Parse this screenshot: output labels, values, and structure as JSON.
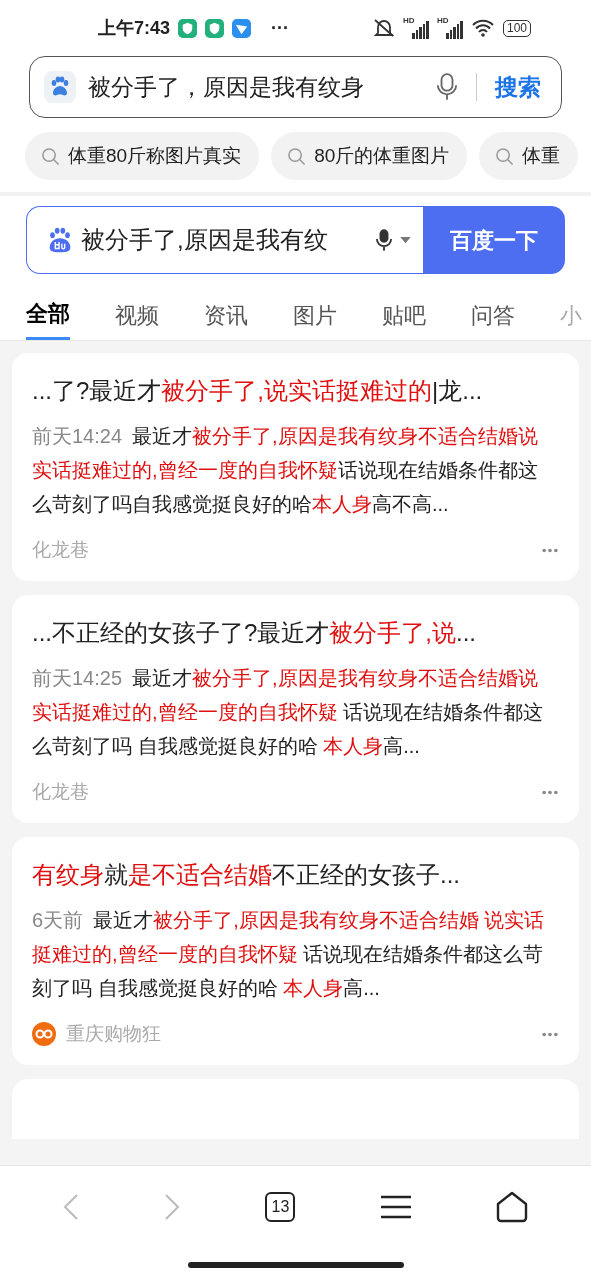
{
  "status_bar": {
    "time": "上午7:43",
    "more": "···",
    "signal_labels": [
      "HD",
      "HD"
    ],
    "battery": "100"
  },
  "top_search": {
    "value": "被分手了，原因是我有纹身",
    "button": "搜索"
  },
  "suggestions": [
    "体重80斤称图片真实",
    "80斤的体重图片",
    "体重"
  ],
  "baidu_search": {
    "value": "被分手了,原因是我有纹",
    "button": "百度一下"
  },
  "tabs": [
    {
      "label": "全部",
      "selected": true
    },
    {
      "label": "视频",
      "selected": false
    },
    {
      "label": "资讯",
      "selected": false
    },
    {
      "label": "图片",
      "selected": false
    },
    {
      "label": "贴吧",
      "selected": false
    },
    {
      "label": "问答",
      "selected": false
    },
    {
      "label": "小",
      "selected": false
    }
  ],
  "results": [
    {
      "title": [
        {
          "text": "...了?最近才",
          "highlight": false
        },
        {
          "text": "被分手了,说实话挺难过的",
          "highlight": true
        },
        {
          "text": "|龙...",
          "highlight": false
        }
      ],
      "date": "前天14:24",
      "snippet": [
        {
          "text": "最近才",
          "highlight": false
        },
        {
          "text": "被分手了,原因是我有纹身不适合结婚说实话挺难过的,曾经一度的自我怀疑",
          "highlight": true
        },
        {
          "text": "话说现在结婚条件都这么苛刻了吗自我感觉挺良好的哈",
          "highlight": false
        },
        {
          "text": "本人身",
          "highlight": true
        },
        {
          "text": "高不高...",
          "highlight": false
        }
      ],
      "source": "化龙巷",
      "source_logo": false
    },
    {
      "title": [
        {
          "text": "...不正经的女孩子了?最近才",
          "highlight": false
        },
        {
          "text": "被分手了,说",
          "highlight": true
        },
        {
          "text": "...",
          "highlight": false
        }
      ],
      "date": "前天14:25",
      "snippet": [
        {
          "text": "最近才",
          "highlight": false
        },
        {
          "text": "被分手了,原因是我有纹身不适合结婚说实话挺难过的,曾经一度的自我怀疑",
          "highlight": true
        },
        {
          "text": " 话说现在结婚条件都这么苛刻了吗 自我感觉挺良好的哈 ",
          "highlight": false
        },
        {
          "text": "本人身",
          "highlight": true
        },
        {
          "text": "高...",
          "highlight": false
        }
      ],
      "source": "化龙巷",
      "source_logo": false
    },
    {
      "title": [
        {
          "text": "有纹身",
          "highlight": true
        },
        {
          "text": "就",
          "highlight": false
        },
        {
          "text": "是不适合结婚",
          "highlight": true
        },
        {
          "text": "不正经的女孩子...",
          "highlight": false
        }
      ],
      "date": "6天前",
      "snippet": [
        {
          "text": "最近才",
          "highlight": false
        },
        {
          "text": "被分手了,原因是我有纹身不适合结婚 说实话挺难过的,曾经一度的自我怀疑",
          "highlight": true
        },
        {
          "text": " 话说现在结婚条件都这么苛刻了吗 自我感觉挺良好的哈 ",
          "highlight": false
        },
        {
          "text": "本人身",
          "highlight": true
        },
        {
          "text": "高...",
          "highlight": false
        }
      ],
      "source": "重庆购物狂",
      "source_logo": true
    }
  ],
  "bottom_nav": {
    "back_disabled": true,
    "forward_disabled": true,
    "tab_count": "13"
  }
}
